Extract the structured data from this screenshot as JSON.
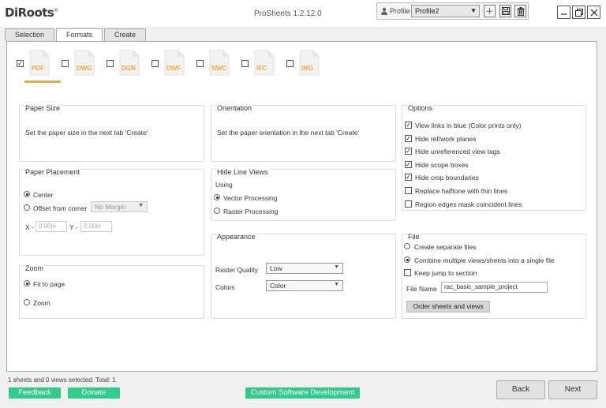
{
  "app": {
    "logo": "DiRoots",
    "title": "ProSheets 1.2.12.0"
  },
  "profile": {
    "label": "Profile",
    "selected": "Profile2"
  },
  "tabs": [
    {
      "label": "Selection"
    },
    {
      "label": "Formats"
    },
    {
      "label": "Create"
    }
  ],
  "formats": [
    {
      "ext": "PDF",
      "checked": true
    },
    {
      "ext": "DWG",
      "checked": false
    },
    {
      "ext": "DGN",
      "checked": false
    },
    {
      "ext": "DWF",
      "checked": false
    },
    {
      "ext": "NWC",
      "checked": false
    },
    {
      "ext": "IFC",
      "checked": false
    },
    {
      "ext": "IMG",
      "checked": false
    }
  ],
  "paper_size": {
    "title": "Paper Size",
    "text": "Set the paper size in the next tab 'Create'"
  },
  "orientation": {
    "title": "Orientation",
    "text": "Set the paper orientation in the next tab 'Create'"
  },
  "placement": {
    "title": "Paper Placement",
    "center": "Center",
    "offset": "Offset from corner",
    "margin_select": "No Margin",
    "x_label": "X -",
    "x_value": "0.00in",
    "y_label": "Y -",
    "y_value": "0.00in"
  },
  "hide_line": {
    "title": "Hide Line Views",
    "using": "Using",
    "vector": "Vector Processing",
    "raster": "Raster Processing"
  },
  "appearance": {
    "title": "Appearance",
    "raster_label": "Raster Quality",
    "raster_value": "Low",
    "colors_label": "Colors",
    "colors_value": "Color"
  },
  "zoom": {
    "title": "Zoom",
    "fit": "Fit to page",
    "zoom": "Zoom"
  },
  "options": {
    "title": "Options",
    "items": [
      {
        "label": "View links in blue (Color prints only)",
        "checked": true
      },
      {
        "label": "Hide ref/work planes",
        "checked": true
      },
      {
        "label": "Hide unreferenced view tags",
        "checked": true
      },
      {
        "label": "Hide scope boxes",
        "checked": true
      },
      {
        "label": "Hide crop boundaries",
        "checked": true
      },
      {
        "label": "Replace halftone with thin lines",
        "checked": false
      },
      {
        "label": "Region edges mask coincident lines",
        "checked": false
      }
    ]
  },
  "file": {
    "title": "File",
    "separate": "Create separate files",
    "combine": "Combine multiple views/sheets into a single file",
    "keep_jump": "Keep jump to section",
    "name_label": "File Name",
    "name_value": "rac_basic_sample_project",
    "order_button": "Order sheets and views"
  },
  "status": "1 sheets and 0 views selected. Total: 1",
  "footer": {
    "feedback": "Feedback",
    "donate": "Donate",
    "custom": "Custom Software Development",
    "back": "Back",
    "next": "Next"
  },
  "colors": {
    "accent_green": "#2fcc8b",
    "pdf_orange": "#f2a93b"
  }
}
